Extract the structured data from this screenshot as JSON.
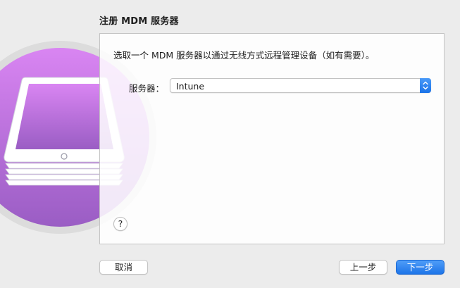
{
  "dialog": {
    "title": "注册 MDM 服务器",
    "instruction": "选取一个 MDM 服务器以通过无线方式远程管理设备（如有需要）。",
    "server_label": "服务器：",
    "server_value": "Intune",
    "help_label": "?"
  },
  "buttons": {
    "cancel": "取消",
    "back": "上一步",
    "next": "下一步"
  },
  "icons": {
    "app": "apple-configurator-ipad-stack-icon",
    "select": "chevron-up-down-icon"
  },
  "colors": {
    "accent": "#1d74e8",
    "art_purple": "#b46fe0"
  }
}
